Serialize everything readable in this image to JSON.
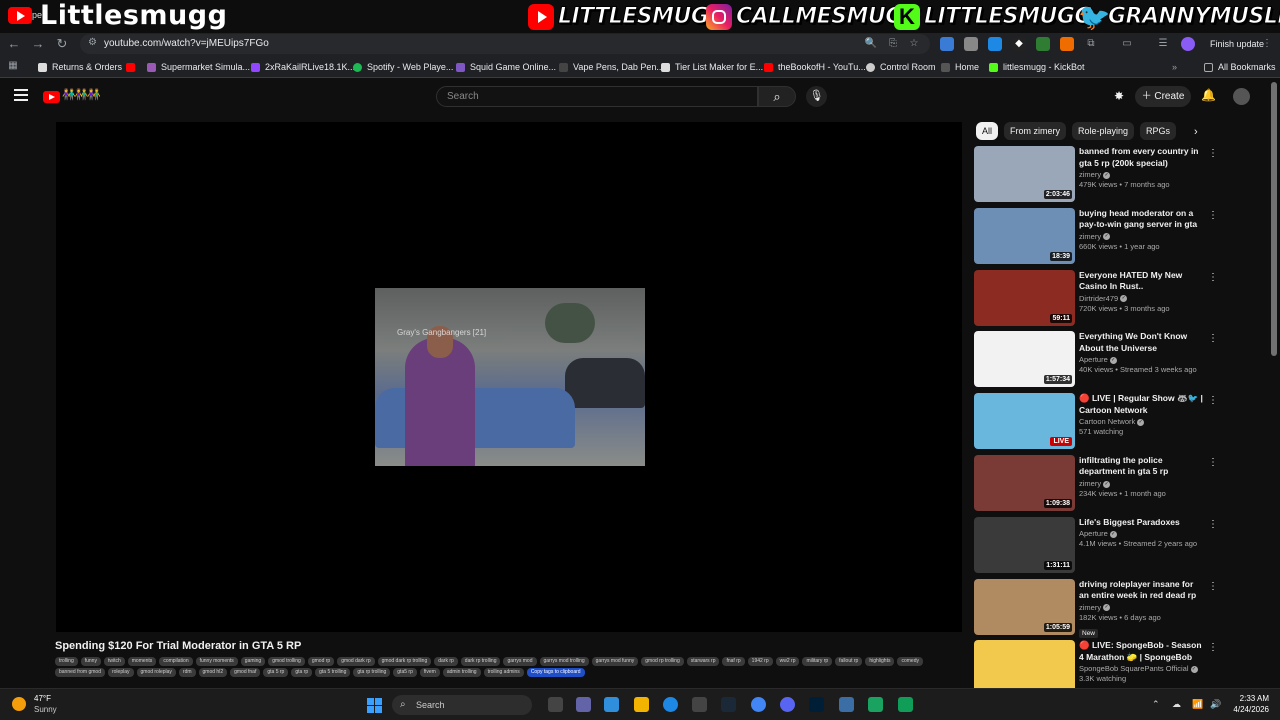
{
  "overlay": {
    "channel_name": "Littlesmugg",
    "tiny_label": "pe",
    "socials": [
      {
        "platform": "youtube",
        "handle": "LITTLESMUGG"
      },
      {
        "platform": "instagram",
        "handle": "CALLMESMUGG"
      },
      {
        "platform": "kick",
        "handle": "LITTLESMUGG"
      },
      {
        "platform": "twitter",
        "handle": "GRANNYMUSLIM"
      }
    ]
  },
  "browser": {
    "url": "youtube.com/watch?v=jMEUips7FGo",
    "finish_update": "Finish update",
    "bookmarks": [
      "Returns & Orders",
      "",
      "Supermarket Simula...",
      "2xRaKailRLive18.1K...",
      "Spotify - Web Playe...",
      "Squid Game Online...",
      "Vape Pens, Dab Pen...",
      "Tier List Maker for E...",
      "theBookofH - YouTu...",
      "Control Room",
      "Home",
      "littlesmugg - KickBot"
    ],
    "all_bookmarks": "All Bookmarks"
  },
  "youtube": {
    "search_placeholder": "Search",
    "create_label": "Create",
    "logo_people": "👫👫👫",
    "video": {
      "title": "Spending $120 For Trial Moderator in GTA 5 RP",
      "overlay_text": "Gray's Gangbangers [21]",
      "tags": [
        "trolling",
        "funny",
        "twitch",
        "moments",
        "compilation",
        "funny moments",
        "gaming",
        "gmod trolling",
        "gmod rp",
        "gmod dark rp",
        "gmod dark rp trolling",
        "dark rp",
        "dark rp trolling",
        "garrys mod",
        "garrys mod trolling",
        "garrys mod funny",
        "gmod rp trolling",
        "starwars rp",
        "fnaf rp",
        "1942 rp",
        "ww2 rp",
        "military rp",
        "fallout rp",
        "highlights",
        "comedy",
        "banned from gmod",
        "roleplay",
        "gmod roleplay",
        "rdm",
        "gmod hl2",
        "gmod fnaf",
        "gta 5 rp",
        "gta rp",
        "gta 5 trolling",
        "gta rp trolling",
        "gta5 rp",
        "fivem",
        "admin trolling",
        "trolling admins"
      ],
      "copy_tags": "Copy tags to clipboard"
    },
    "chips": [
      "All",
      "From zimery",
      "Role-playing",
      "RPGs"
    ],
    "recommendations": [
      {
        "title": "banned from every country in gta 5 rp (200k special)",
        "channel": "zimery",
        "meta": "479K views • 7 months ago",
        "duration": "2:03:46",
        "thumb": "#9aa7b8"
      },
      {
        "title": "buying head moderator on a pay-to-win gang server in gta ...",
        "channel": "zimery",
        "meta": "660K views • 1 year ago",
        "duration": "18:39",
        "thumb": "#6d8fb5"
      },
      {
        "title": "Everyone HATED My New Casino In Rust..",
        "channel": "Dirtrider479",
        "meta": "720K views • 3 months ago",
        "duration": "59:11",
        "thumb": "#8b2b22"
      },
      {
        "title": "Everything We Don't Know About the Universe",
        "channel": "Aperture",
        "meta": "40K views • Streamed 3 weeks ago",
        "duration": "1:57:34",
        "thumb": "#f2f2f2"
      },
      {
        "title": "🔴 LIVE | Regular Show 🦝🐦 | Cartoon Network",
        "channel": "Cartoon Network",
        "meta": "571 watching",
        "live": "LIVE",
        "thumb": "#6ab7de"
      },
      {
        "title": "infiltrating the police department in gta 5 rp",
        "channel": "zimery",
        "meta": "234K views • 1 month ago",
        "duration": "1:09:38",
        "thumb": "#7a3a35"
      },
      {
        "title": "Life's Biggest Paradoxes",
        "channel": "Aperture",
        "meta": "4.1M views • Streamed 2 years ago",
        "duration": "1:31:11",
        "thumb": "#3a3a3a"
      },
      {
        "title": "driving roleplayer insane for an entire week in red dead rp",
        "channel": "zimery",
        "meta": "182K views • 6 days ago",
        "duration": "1:05:59",
        "badge": "New",
        "thumb": "#b08a60"
      },
      {
        "title": "🔴 LIVE: SpongeBob - Season 4 Marathon 🧽 | SpongeBob",
        "channel": "SpongeBob SquarePants Official",
        "meta": "3.3K watching",
        "thumb": "#f2c94c"
      }
    ]
  },
  "taskbar": {
    "temperature": "47°F",
    "condition": "Sunny",
    "search": "Search",
    "time": "2:33 AM",
    "date": "4/24/2026"
  }
}
